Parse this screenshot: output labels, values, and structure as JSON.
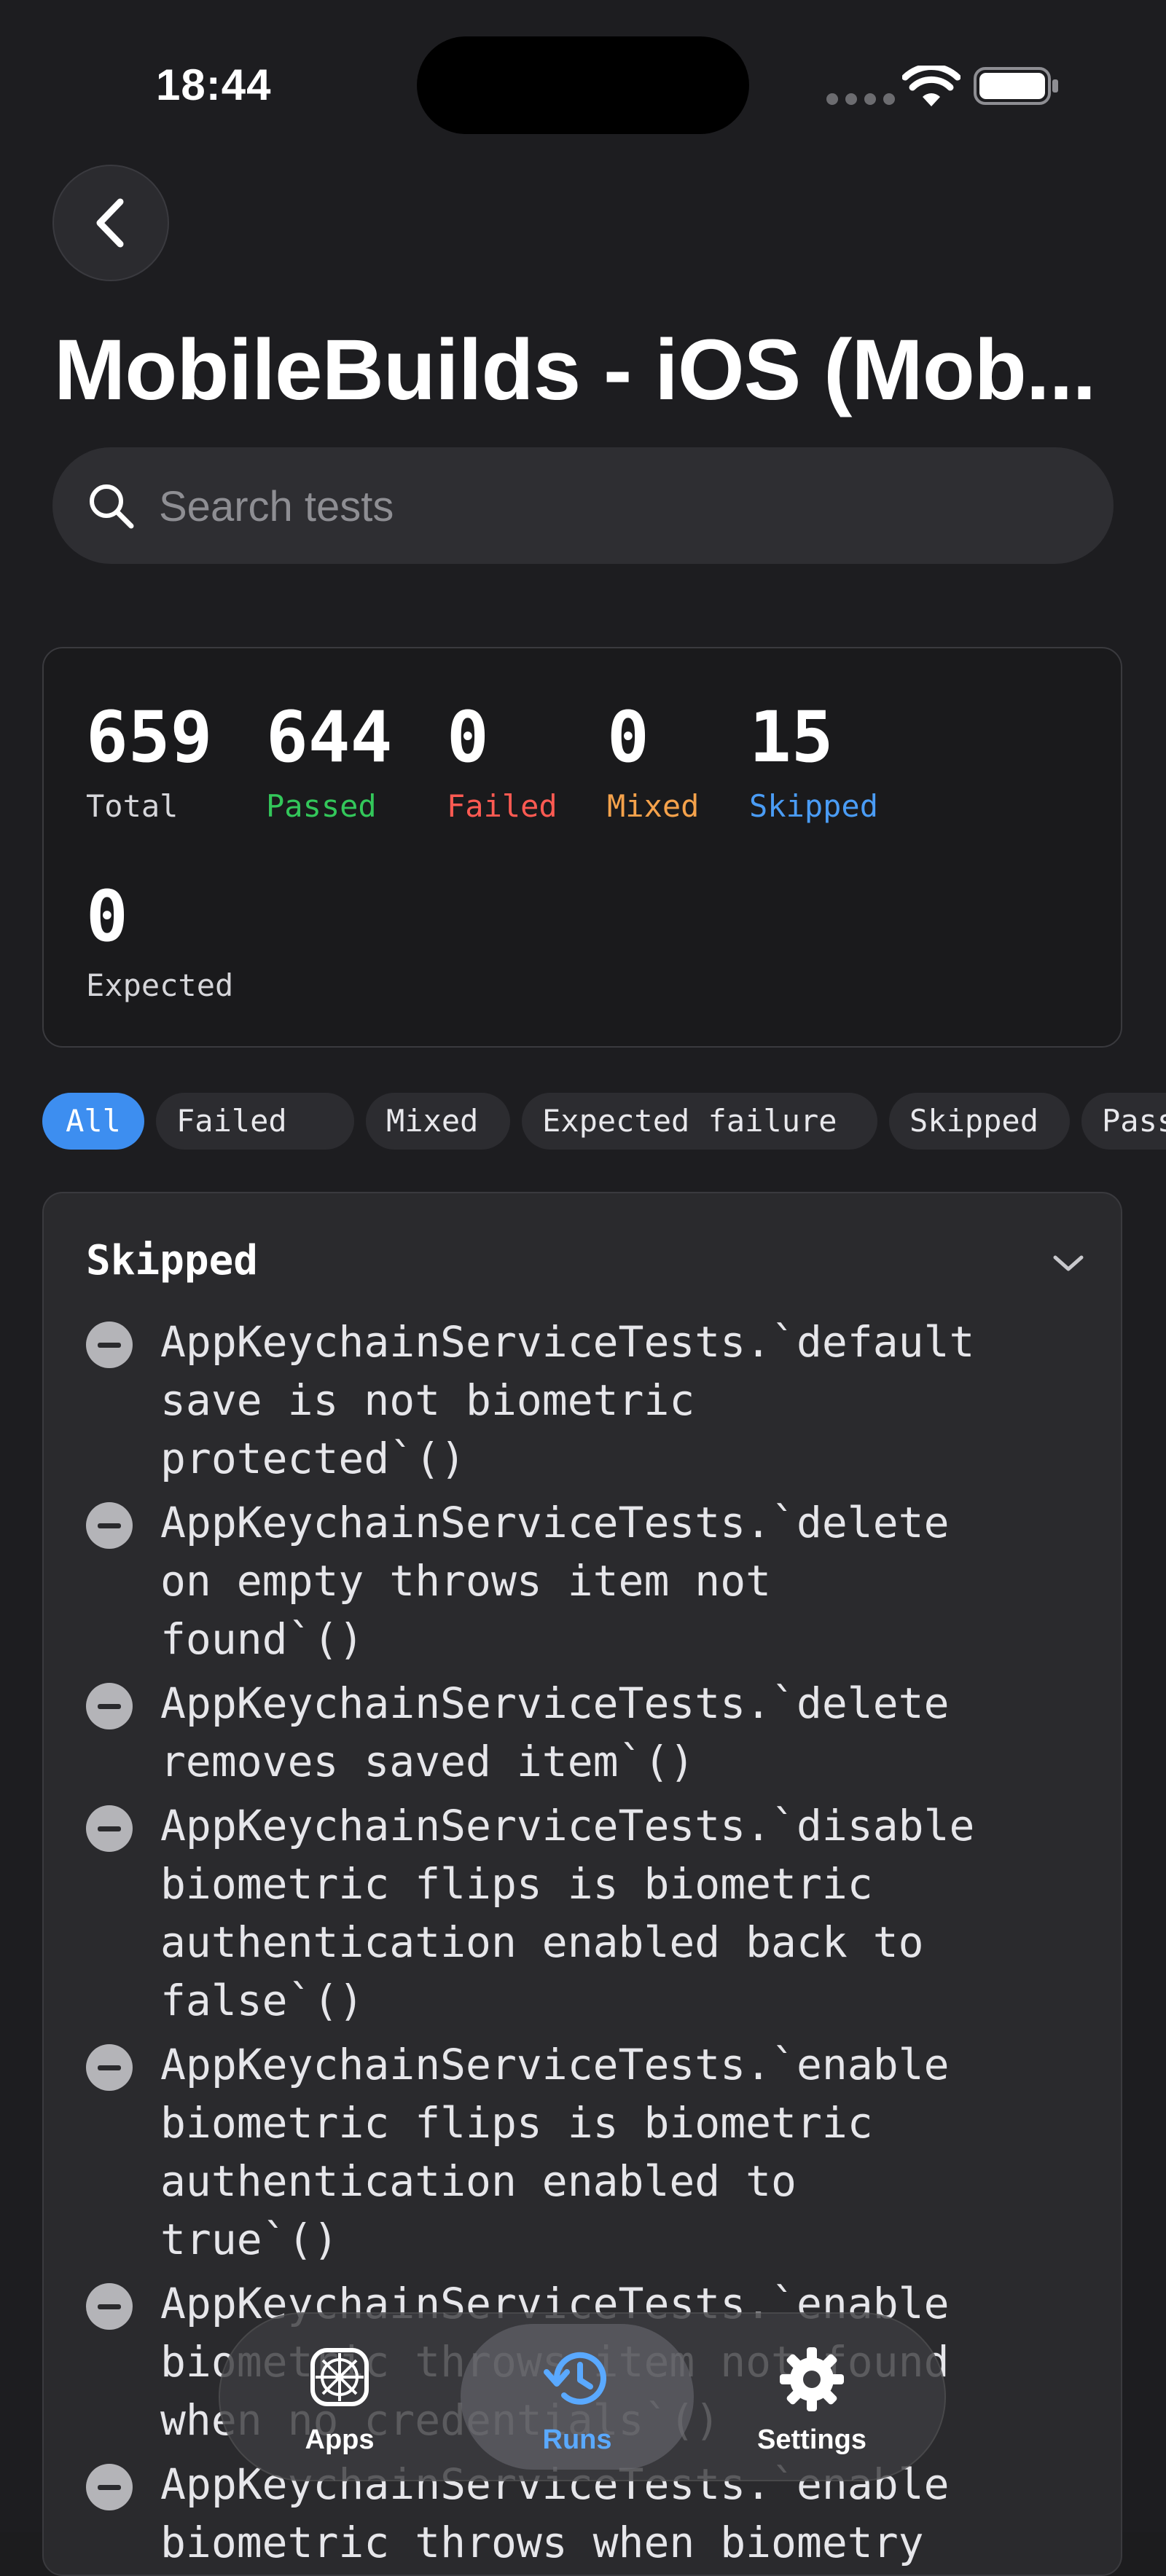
{
  "status_bar": {
    "time": "18:44"
  },
  "header": {
    "title": "MobileBuilds - iOS (Mob..."
  },
  "search": {
    "placeholder": "Search tests"
  },
  "summary": {
    "total": {
      "value": "659",
      "label": "Total"
    },
    "passed": {
      "value": "644",
      "label": "Passed"
    },
    "failed": {
      "value": "0",
      "label": "Failed"
    },
    "mixed": {
      "value": "0",
      "label": "Mixed"
    },
    "skipped": {
      "value": "15",
      "label": "Skipped"
    },
    "expected": {
      "value": "0",
      "label": "Expected"
    }
  },
  "filters": [
    "All",
    "Failed",
    "Mixed",
    "Expected failure",
    "Skipped",
    "Passed"
  ],
  "section": {
    "title": "Skipped",
    "tests": [
      "AppKeychainServiceTests.`default\nsave is not biometric\nprotected`()",
      "AppKeychainServiceTests.`delete\non empty throws item not\nfound`()",
      "AppKeychainServiceTests.`delete\nremoves saved item`()",
      "AppKeychainServiceTests.`disable\nbiometric flips is biometric\nauthentication enabled back to\nfalse`()",
      "AppKeychainServiceTests.`enable\nbiometric flips is biometric\nauthentication enabled to\ntrue`()",
      "AppKeychainServiceTests.`enable\nbiometric throws item not found\nwhen no credentials`()",
      "AppKeychainServiceTests.`enable\nbiometric throws when biometry"
    ]
  },
  "tabbar": {
    "apps": "Apps",
    "runs": "Runs",
    "settings": "Settings"
  },
  "colors": {
    "passed": "#33c75a",
    "failed": "#ff5a52",
    "mixed": "#f5a24b",
    "skipped": "#4a9cf5",
    "accent": "#3d8ef0"
  }
}
